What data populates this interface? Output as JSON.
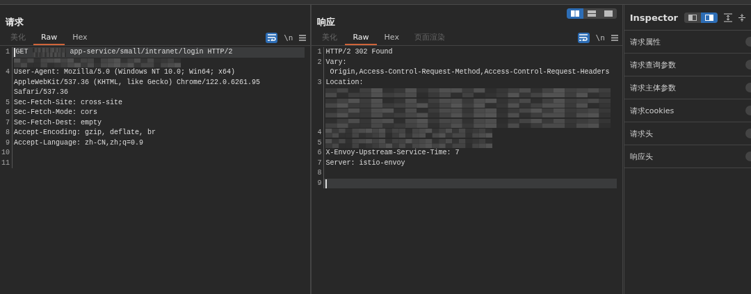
{
  "request": {
    "title": "请求",
    "tabs": [
      {
        "label": "美化",
        "selected": false,
        "disabled": true
      },
      {
        "label": "Raw",
        "selected": true,
        "disabled": false
      },
      {
        "label": "Hex",
        "selected": false,
        "disabled": false
      }
    ],
    "wrap": {
      "on": true
    },
    "newline_toggle": {
      "label": "\\n",
      "on": false
    },
    "lines": [
      {
        "number": "1",
        "current": true,
        "parts": [
          {
            "kind": "text",
            "text": "GET"
          },
          {
            "kind": "redacted"
          },
          {
            "kind": "text",
            "text": "app-service/small/intranet/login HTTP/2"
          }
        ]
      },
      {
        "current": false,
        "parts": [
          {
            "kind": "redacted"
          }
        ]
      },
      {
        "number": "4",
        "current": false,
        "parts": [
          {
            "kind": "text",
            "text": "User-Agent: Mozilla/5.0 (Windows NT 10.0; Win64; x64) AppleWebKit/537.36 (KHTML, like Gecko) Chrome/122.0.6261.95 Safari/537.36"
          }
        ]
      },
      {
        "number": "5",
        "current": false,
        "parts": [
          {
            "kind": "text",
            "text": "Sec-Fetch-Site: cross-site"
          }
        ]
      },
      {
        "number": "6",
        "current": false,
        "parts": [
          {
            "kind": "text",
            "text": "Sec-Fetch-Mode: cors"
          }
        ]
      },
      {
        "number": "7",
        "current": false,
        "parts": [
          {
            "kind": "text",
            "text": "Sec-Fetch-Dest: empty"
          }
        ]
      },
      {
        "number": "8",
        "current": false,
        "parts": [
          {
            "kind": "text",
            "text": "Accept-Encoding: gzip, deflate, br"
          }
        ]
      },
      {
        "number": "9",
        "current": false,
        "parts": [
          {
            "kind": "text",
            "text": "Accept-Language: zh-CN,zh;q=0.9"
          }
        ]
      },
      {
        "number": "10",
        "current": false
      },
      {
        "number": "11",
        "current": false
      }
    ]
  },
  "response": {
    "title": "响应",
    "layout_buttons": [
      {
        "selected": true
      },
      {
        "selected": false
      },
      {
        "selected": false
      }
    ],
    "tabs": [
      {
        "label": "美化",
        "selected": false,
        "disabled": true
      },
      {
        "label": "Raw",
        "selected": true,
        "disabled": false
      },
      {
        "label": "Hex",
        "selected": false,
        "disabled": false
      },
      {
        "label": "页面渲染",
        "selected": false,
        "disabled": true
      }
    ],
    "wrap": {
      "on": true
    },
    "newline_toggle": {
      "label": "\\n",
      "on": false
    },
    "lines": [
      {
        "number": "1",
        "current": false,
        "parts": [
          {
            "kind": "text",
            "text": "HTTP/2 302 Found"
          }
        ]
      },
      {
        "number": "2",
        "current": false,
        "parts": [
          {
            "kind": "text",
            "text": "Vary:"
          },
          {
            "kind": "text",
            "text": "Origin,Access-Control-Request-Method,Access-Control-Request-Headers"
          }
        ]
      },
      {
        "number": "3",
        "current": false,
        "parts": [
          {
            "kind": "text",
            "text": "Location:"
          }
        ]
      },
      {
        "current": false,
        "parts": [
          {
            "kind": "redacted"
          }
        ]
      },
      {
        "current": false,
        "parts": [
          {
            "kind": "redacted"
          }
        ]
      },
      {
        "current": false,
        "parts": [
          {
            "kind": "redacted"
          }
        ]
      },
      {
        "current": false,
        "parts": [
          {
            "kind": "redacted"
          }
        ]
      },
      {
        "number": "4",
        "current": false,
        "parts": [
          {
            "kind": "redacted"
          }
        ]
      },
      {
        "number": "5",
        "current": false,
        "parts": [
          {
            "kind": "redacted"
          }
        ]
      },
      {
        "number": "6",
        "current": false,
        "parts": [
          {
            "kind": "text",
            "text": "X-Envoy-Upstream-Service-Time: 7"
          }
        ]
      },
      {
        "number": "7",
        "current": false,
        "parts": [
          {
            "kind": "text",
            "text": "Server: istio-envoy"
          }
        ]
      },
      {
        "number": "8",
        "current": false
      },
      {
        "number": "9",
        "current": true
      }
    ]
  },
  "inspector": {
    "title": "Inspector",
    "view_buttons": [
      {
        "selected": false
      },
      {
        "selected": true
      }
    ],
    "sections": [
      {
        "label": "请求属性"
      },
      {
        "label": "请求查询参数"
      },
      {
        "label": "请求主体参数"
      },
      {
        "label": "请求cookies"
      },
      {
        "label": "请求头"
      },
      {
        "label": "响应头"
      }
    ]
  }
}
